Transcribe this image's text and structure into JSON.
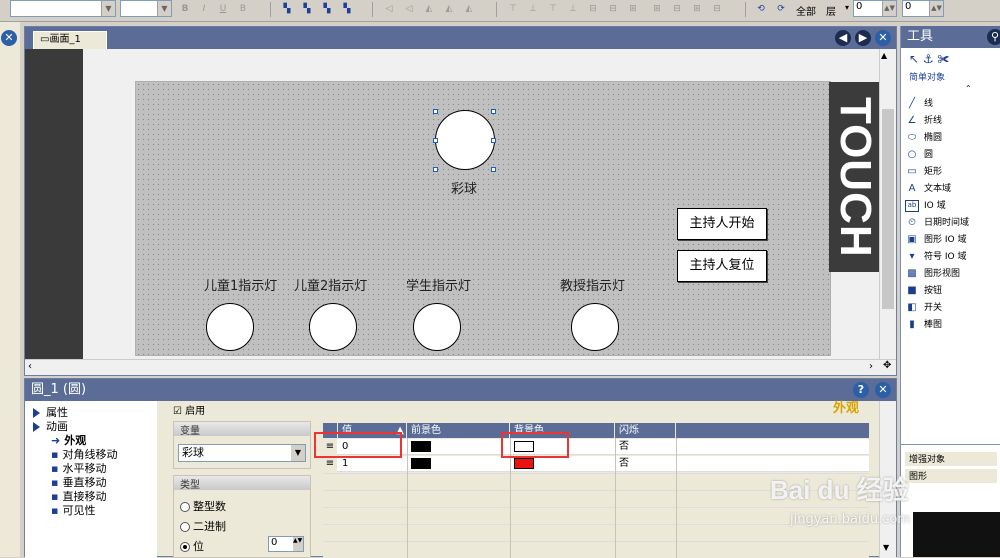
{
  "toolbar": {
    "format_buttons": [
      "B",
      "I",
      "U",
      "B"
    ],
    "zoom_label": "全部",
    "layer_label": "层",
    "layer_value": "0",
    "second_value": "0"
  },
  "screen": {
    "tab_label": "画面_1",
    "touch_text": "TOUCH",
    "ball_label": "彩球",
    "lamps": [
      {
        "label": "儿童1指示灯"
      },
      {
        "label": "儿童2指示灯"
      },
      {
        "label": "学生指示灯"
      },
      {
        "label": "教授指示灯"
      }
    ],
    "buttons": [
      {
        "label": "主持人开始"
      },
      {
        "label": "主持人复位"
      }
    ]
  },
  "tools": {
    "title": "工具",
    "group1": "简单对象",
    "items": [
      {
        "icon": "line-icon",
        "glyph": "╱",
        "label": "线"
      },
      {
        "icon": "polyline-icon",
        "glyph": "∠",
        "label": "折线"
      },
      {
        "icon": "ellipse-icon",
        "glyph": "⬭",
        "label": "椭圆"
      },
      {
        "icon": "circle-icon",
        "glyph": "○",
        "label": "圆"
      },
      {
        "icon": "rectangle-icon",
        "glyph": "▭",
        "label": "矩形"
      },
      {
        "icon": "text-icon",
        "glyph": "A",
        "label": "文本域"
      },
      {
        "icon": "io-field-icon",
        "glyph": "ab",
        "label": "IO 域"
      },
      {
        "icon": "datetime-icon",
        "glyph": "⏲",
        "label": "日期时间域"
      },
      {
        "icon": "graphic-io-icon",
        "glyph": "▣",
        "label": "图形 IO 域"
      },
      {
        "icon": "symbol-io-icon",
        "glyph": "▾",
        "label": "符号 IO 域"
      },
      {
        "icon": "graphic-view-icon",
        "glyph": "▩",
        "label": "图形视图"
      },
      {
        "icon": "button-icon",
        "glyph": "■",
        "label": "按钮"
      },
      {
        "icon": "switch-icon",
        "glyph": "◧",
        "label": "开关"
      },
      {
        "icon": "bar-icon",
        "glyph": "▮",
        "label": "棒图"
      }
    ],
    "group2": "增强对象",
    "group3": "图形"
  },
  "props": {
    "title": "圆_1 (圆)",
    "tree": [
      {
        "label": "属性"
      },
      {
        "label": "动画"
      },
      {
        "label": "外观"
      },
      {
        "label": "对角线移动"
      },
      {
        "label": "水平移动"
      },
      {
        "label": "垂直移动"
      },
      {
        "label": "直接移动"
      },
      {
        "label": "可见性"
      }
    ],
    "enable_label": "启用",
    "section_title": "外观",
    "variable_group": "变量",
    "variable_value": "彩球",
    "type_group": "类型",
    "type_options": [
      "整型数",
      "二进制",
      "位"
    ],
    "bit_value": "0",
    "table": {
      "headers": [
        "值",
        "前景色",
        "背景色",
        "闪烁"
      ],
      "rows": [
        {
          "value": "0",
          "fg": "#000000",
          "bg": "#ffffff",
          "blink": "否"
        },
        {
          "value": "1",
          "fg": "#000000",
          "bg": "#ee1111",
          "blink": "否"
        }
      ]
    }
  },
  "watermark": {
    "logo": "Bai du 经验",
    "url": "jingyan.baidu.com"
  }
}
